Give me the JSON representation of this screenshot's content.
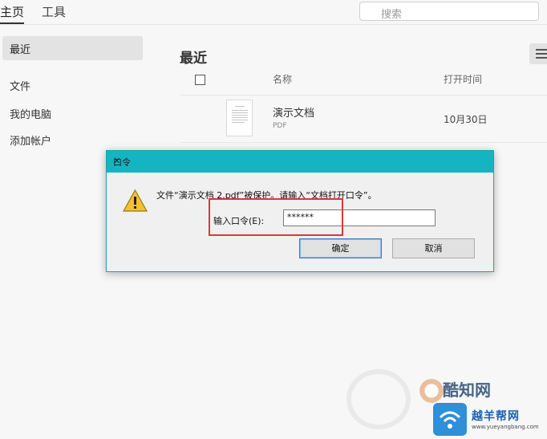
{
  "topbar": {
    "tab_home": "主页",
    "tab_tools": "工具",
    "search_placeholder": "搜索"
  },
  "sidebar": {
    "recent": "最近",
    "files": "文件",
    "my_computer": "我的电脑",
    "add_account": "添加帐户"
  },
  "main": {
    "title": "最近",
    "columns": {
      "name": "名称",
      "open_time": "打开时间"
    },
    "files": [
      {
        "name": "演示文档",
        "type": "PDF",
        "time": "10月30日"
      }
    ]
  },
  "dialog": {
    "title": "口令",
    "message": "文件“演示文档 2.pdf”被保护。请输入“文档打开口令”。",
    "password_label": "输入口令(E):",
    "password_value": "******",
    "ok_label": "确定",
    "cancel_label": "取消"
  },
  "watermark": {
    "text1": "酷知网",
    "text2": "越羊帮网",
    "text3": "www.yueyangbang.com"
  },
  "colors": {
    "dialog_titlebar": "#15b4c1",
    "highlight": "#d23b3b",
    "accent_blue": "#3b7dc4"
  }
}
